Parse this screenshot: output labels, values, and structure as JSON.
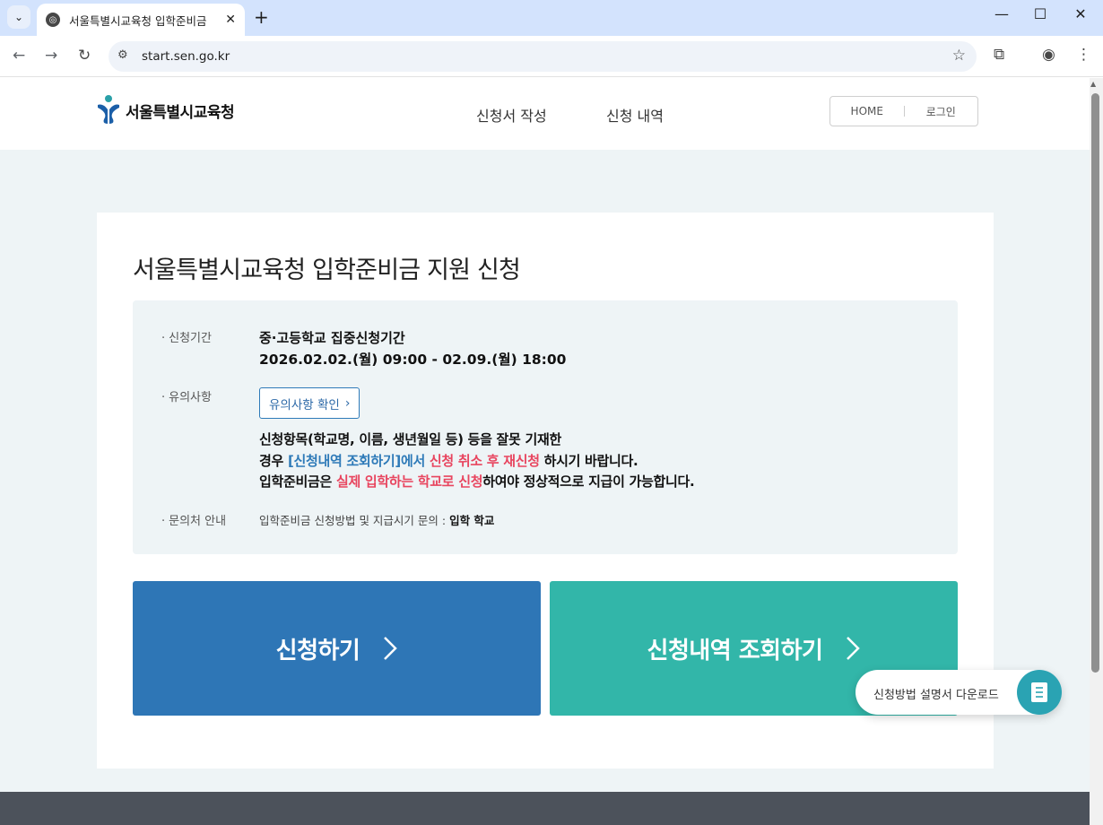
{
  "browser": {
    "tab_title": "서울특별시교육청 입학준비금",
    "url": "start.sen.go.kr",
    "new_tab": "+",
    "tab_close": "✕",
    "min": "—",
    "max": "☐",
    "close": "✕"
  },
  "header": {
    "logo_text": "서울특별시교육청",
    "nav": [
      "신청서 작성",
      "신청 내역"
    ],
    "util": [
      "HOME",
      "로그인"
    ]
  },
  "main": {
    "title": "서울특별시교육청 입학준비금 지원 신청",
    "period_label": "신청기간",
    "period_line1": "중·고등학교 집중신청기간",
    "period_line2": "2026.02.02.(월) 09:00 - 02.09.(월) 18:00",
    "notice_label": "유의사항",
    "notice_button": "유의사항 확인",
    "notice": {
      "line1": "신청항목(학교명, 이름, 생년월일 등) 등을 잘못 기재한",
      "line2_a": "경우 ",
      "line2_b": "[신청내역 조회하기]에서",
      "line2_c": " ",
      "line2_d": "신청 취소 후 재신청",
      "line2_e": " 하시기 바랍니다.",
      "line3_a": "입학준비금은 ",
      "line3_b": "실제 입학하는 학교로 신청",
      "line3_c": "하여야 정상적으로 지급이 가능합니다."
    },
    "contact_label": "문의처 안내",
    "contact_text": "입학준비금 신청방법 및 지급시기 문의 : ",
    "contact_bold": "입학 학교",
    "apply_button": "신청하기",
    "history_button": "신청내역 조회하기"
  },
  "floating": {
    "download_label": "신청방법 설명서 다운로드"
  },
  "colors": {
    "primary_blue": "#2e76b6",
    "teal": "#32b6a9",
    "highlight_red": "#e8455f",
    "link_blue": "#2e7ab8"
  },
  "icons": [
    "globe-icon",
    "tab-search-icon",
    "back-icon",
    "forward-icon",
    "reload-icon",
    "site-info-icon",
    "star-icon",
    "extensions-icon",
    "profile-icon",
    "menu-icon",
    "chevron-right-icon",
    "document-icon"
  ]
}
